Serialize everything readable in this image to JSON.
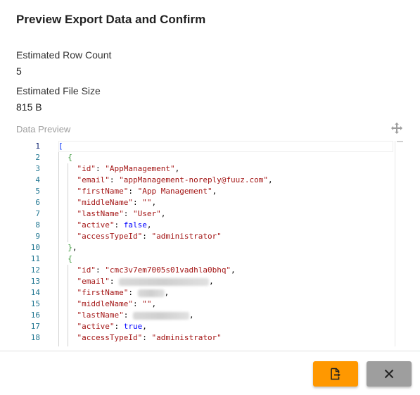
{
  "dialog": {
    "title": "Preview Export Data and Confirm"
  },
  "summary": {
    "row_count_label": "Estimated Row Count",
    "row_count_value": "5",
    "file_size_label": "Estimated File Size",
    "file_size_value": "815 B"
  },
  "preview": {
    "label": "Data Preview",
    "move_icon": "move-arrows-icon",
    "line_numbers": [
      "1",
      "2",
      "3",
      "4",
      "5",
      "6",
      "7",
      "8",
      "9",
      "10",
      "11",
      "12",
      "13",
      "14",
      "15",
      "16",
      "17",
      "18"
    ],
    "active_line": "1",
    "records": [
      {
        "id": "AppManagement",
        "email": "appManagement-noreply@fuuz.com",
        "firstName": "App Management",
        "middleName": "",
        "lastName": "User",
        "active": "false",
        "accessTypeId": "administrator"
      },
      {
        "id": "cmc3v7em7005s01vadhla0bhq",
        "email": "[redacted]",
        "firstName": "[redacted]",
        "middleName": "",
        "lastName": "[redacted]",
        "active": "true",
        "accessTypeId": "administrator"
      }
    ],
    "keys": {
      "id": "\"id\"",
      "email": "\"email\"",
      "firstName": "\"firstName\"",
      "middleName": "\"middleName\"",
      "lastName": "\"lastName\"",
      "active": "\"active\"",
      "accessTypeId": "\"accessTypeId\""
    },
    "values": {
      "r1_id": "\"AppManagement\"",
      "r1_email": "\"appManagement-noreply@fuuz.com\"",
      "r1_firstName": "\"App Management\"",
      "r1_middleName": "\"\"",
      "r1_lastName": "\"User\"",
      "r1_active": "false",
      "r1_accessTypeId": "\"administrator\"",
      "r2_id": "\"cmc3v7em7005s01vadhla0bhq\"",
      "r2_middleName": "\"\"",
      "r2_active": "true",
      "r2_accessTypeId": "\"administrator\""
    }
  },
  "actions": {
    "export_icon": "export-file-icon",
    "close_icon": "close-icon"
  },
  "colors": {
    "export_button": "#ff9800",
    "close_button": "#9e9e9e",
    "line_number": "#237893",
    "json_string": "#a31515",
    "json_boolean": "#0000ff",
    "bracket_outer": "#0431fa",
    "bracket_inner": "#319331"
  }
}
